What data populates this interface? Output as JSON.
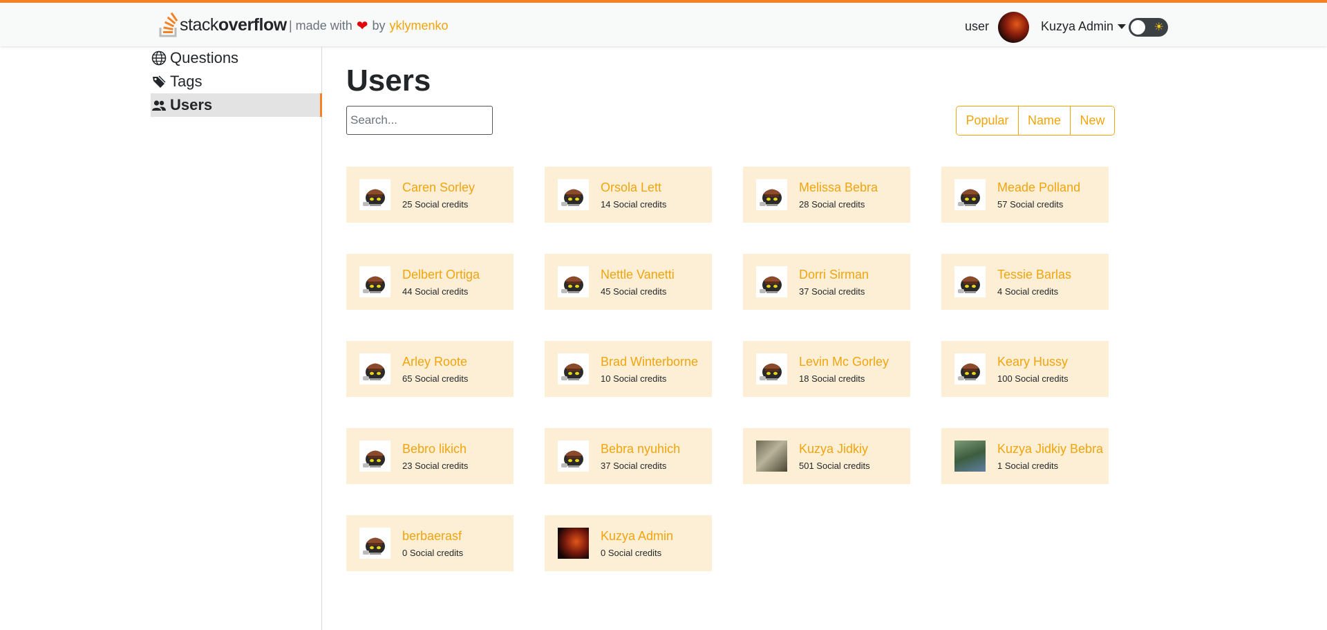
{
  "header": {
    "brand_plain": "stack",
    "brand_bold": "overflow",
    "made_with_prefix": "| made with",
    "heart": "❤",
    "made_with_by": "by",
    "author": "yklymenko",
    "role_label": "user",
    "account_name": "Kuzya Admin",
    "theme_icon": "sun-icon"
  },
  "sidebar": {
    "items": [
      {
        "label": "Questions",
        "icon": "globe-icon",
        "active": false
      },
      {
        "label": "Tags",
        "icon": "tag-icon",
        "active": false
      },
      {
        "label": "Users",
        "icon": "users-icon",
        "active": true
      }
    ]
  },
  "main": {
    "title": "Users",
    "search_placeholder": "Search...",
    "sort_options": [
      "Popular",
      "Name",
      "New"
    ]
  },
  "users": [
    {
      "name": "Caren Sorley",
      "credits": "25 Social credits",
      "avatar": "default"
    },
    {
      "name": "Orsola Lett",
      "credits": "14 Social credits",
      "avatar": "default"
    },
    {
      "name": "Melissa Bebra",
      "credits": "28 Social credits",
      "avatar": "default"
    },
    {
      "name": "Meade Polland",
      "credits": "57 Social credits",
      "avatar": "default"
    },
    {
      "name": "Delbert Ortiga",
      "credits": "44 Social credits",
      "avatar": "default"
    },
    {
      "name": "Nettle Vanetti",
      "credits": "45 Social credits",
      "avatar": "default"
    },
    {
      "name": "Dorri Sirman",
      "credits": "37 Social credits",
      "avatar": "default"
    },
    {
      "name": "Tessie Barlas",
      "credits": "4 Social credits",
      "avatar": "default"
    },
    {
      "name": "Arley Roote",
      "credits": "65 Social credits",
      "avatar": "default"
    },
    {
      "name": "Brad Winterborne",
      "credits": "10 Social credits",
      "avatar": "default"
    },
    {
      "name": "Levin Mc Gorley",
      "credits": "18 Social credits",
      "avatar": "default"
    },
    {
      "name": "Keary Hussy",
      "credits": "100 Social credits",
      "avatar": "default"
    },
    {
      "name": "Bebro likich",
      "credits": "23 Social credits",
      "avatar": "default"
    },
    {
      "name": "Bebra nyuhich",
      "credits": "37 Social credits",
      "avatar": "default"
    },
    {
      "name": "Kuzya Jidkiy",
      "credits": "501 Social credits",
      "avatar": "cat-photo"
    },
    {
      "name": "Kuzya Jidkiy Bebra",
      "credits": "1 Social credits",
      "avatar": "field-photo"
    },
    {
      "name": "berbaerasf",
      "credits": "0 Social credits",
      "avatar": "default"
    },
    {
      "name": "Kuzya Admin",
      "credits": "0 Social credits",
      "avatar": "fire-photo"
    }
  ],
  "colors": {
    "accent": "#f48225",
    "link": "#f2a40b",
    "card_bg": "#fdefd6",
    "heart": "#e0070b"
  }
}
